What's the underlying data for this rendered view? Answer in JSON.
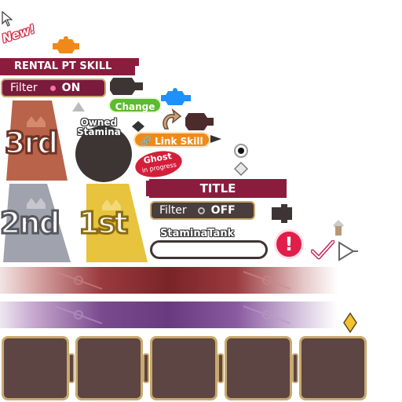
{
  "badges": {
    "new": "New!",
    "ghost_title": "Ghost",
    "ghost_sub": "in progress"
  },
  "rental": {
    "title": "RENTAL PT SKILL",
    "filter_label": "Filter",
    "filter_state": "ON"
  },
  "buttons": {
    "change": "Change",
    "link_skill": "Link Skill"
  },
  "owned_stamina": {
    "line1": "Owned",
    "line2": "Stamina"
  },
  "title_panel": {
    "title": "TITLE",
    "filter_label": "Filter",
    "filter_state": "OFF"
  },
  "stamina_tank": {
    "label": "StaminaTank"
  },
  "ranks": {
    "first": "1st",
    "second": "2nd",
    "third": "3rd"
  },
  "alert": {
    "symbol": "!"
  },
  "colors": {
    "maroon": "#8a1d3e",
    "gold_border": "#c9a96e",
    "slot_fill": "#5c4542",
    "green": "#5dbb2e",
    "orange": "#ef8a1a",
    "blue": "#1e90ff",
    "alert_red": "#e01e49",
    "rank1": "#e7c33e",
    "rank2": "#a0a3ad",
    "rank3": "#b8634a"
  },
  "icons": [
    "cursor-arrow-icon",
    "orange-puzzle-icon",
    "blue-puzzle-icon",
    "green-check-icon",
    "pink-check-icon",
    "play-arrow-icon",
    "gold-diamond-icon",
    "link-icon",
    "refresh-arrow-icon",
    "radio-selected-icon",
    "diamond-outline-icon"
  ]
}
